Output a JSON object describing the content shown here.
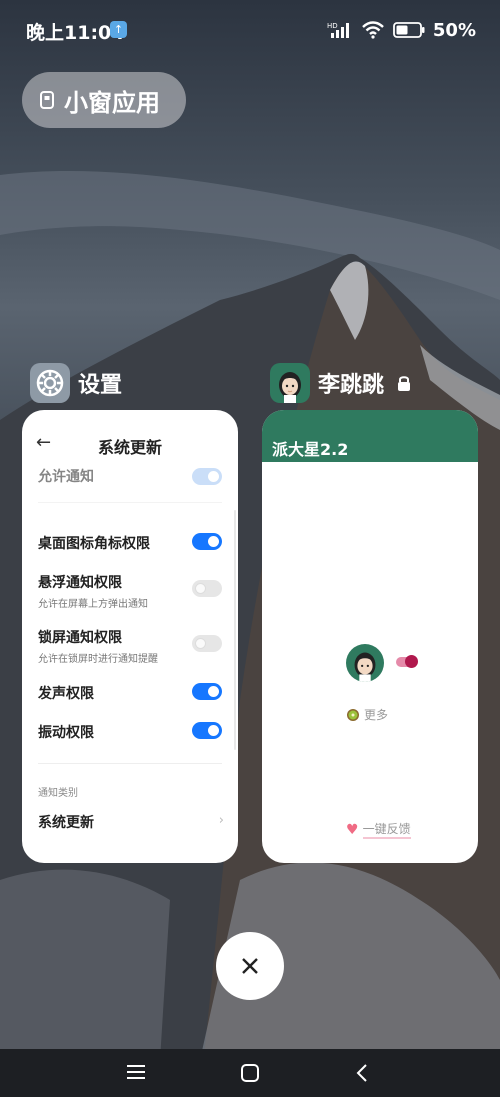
{
  "status_bar": {
    "time": "晚上11:04",
    "upload_badge": "↑",
    "signal_label": "HD",
    "battery_pct": "50%"
  },
  "small_window": {
    "label": "小窗应用"
  },
  "apps": {
    "settings": {
      "name": "设置",
      "page_title": "系统更新",
      "rows": [
        {
          "title": "允许通知",
          "toggle": "on-faded"
        },
        {
          "title": "桌面图标角标权限",
          "toggle": "on"
        },
        {
          "title": "悬浮通知权限",
          "subtitle": "允许在屏幕上方弹出通知",
          "toggle": "off"
        },
        {
          "title": "锁屏通知权限",
          "subtitle": "允许在锁屏时进行通知提醒",
          "toggle": "off"
        },
        {
          "title": "发声权限",
          "toggle": "on"
        },
        {
          "title": "振动权限",
          "toggle": "on"
        }
      ],
      "section_label": "通知类别",
      "category_item": "系统更新"
    },
    "pai": {
      "name": "李跳跳",
      "header_title": "派大星2.2",
      "more_label": "更多",
      "feedback_label": "一键反馈"
    }
  },
  "colors": {
    "accent_blue": "#1677ff",
    "pai_green": "#2f7a5f",
    "pai_pink": "#b0184d"
  },
  "icons": {
    "settings_app": "gear-icon",
    "lock": "lock-icon",
    "close": "close-icon",
    "back": "back-arrow-icon"
  }
}
